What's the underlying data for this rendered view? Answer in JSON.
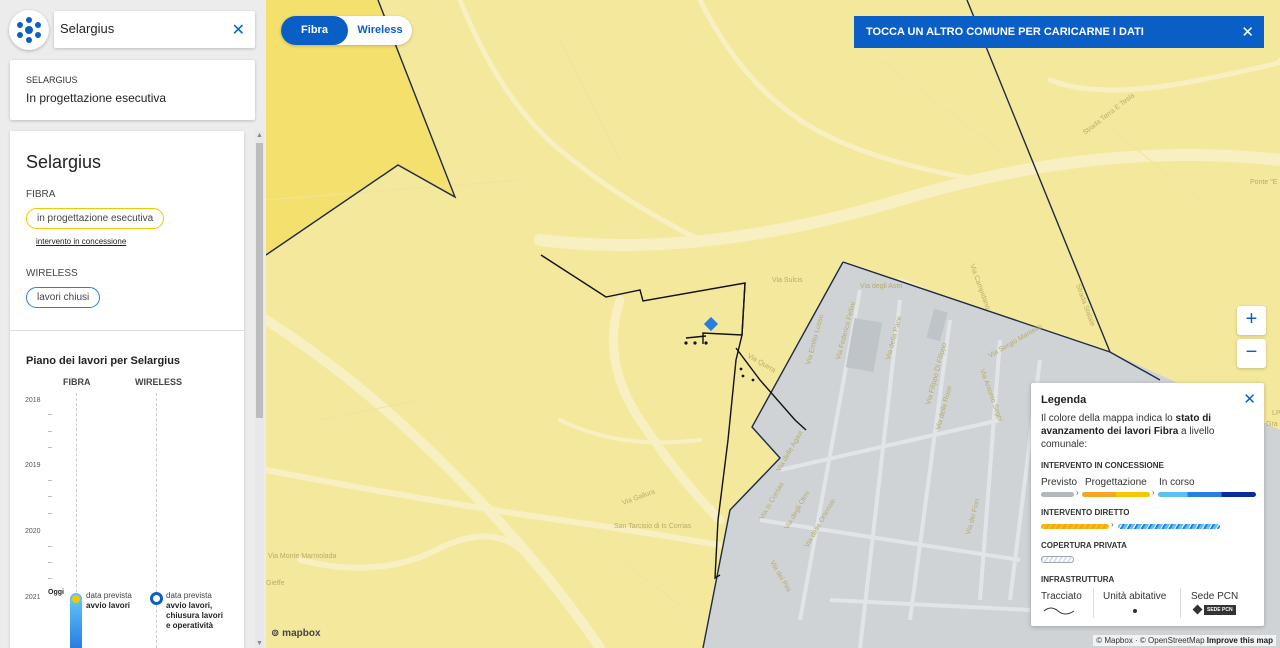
{
  "search": {
    "value": "Selargius",
    "clear_icon": "close-icon"
  },
  "status_card": {
    "comune": "SELARGIUS",
    "status": "In progettazione esecutiva"
  },
  "panel": {
    "title": "Selargius",
    "fibra_label": "FIBRA",
    "fibra_pill": "in progettazione esecutiva",
    "fibra_link": "intervento in concessione",
    "wireless_label": "WIRELESS",
    "wireless_pill": "lavori chiusi",
    "plan_title": "Piano dei lavori per Selargius",
    "col_fibra": "FIBRA",
    "col_wireless": "WIRELESS",
    "years": [
      "2018",
      "2019",
      "2020",
      "2021"
    ],
    "oggi": "Oggi",
    "fibra_event": [
      "data prevista",
      "avvio lavori"
    ],
    "wireless_event": [
      "data prevista",
      "avvio lavori,",
      "chiusura lavori",
      "e operatività"
    ]
  },
  "toggle": {
    "active": "Fibra",
    "inactive": "Wireless"
  },
  "banner": {
    "text": "TOCCA UN ALTRO COMUNE PER CARICARNE I DATI"
  },
  "zoom": {
    "in": "+",
    "out": "−"
  },
  "legend": {
    "title": "Legenda",
    "desc_pre": "Il colore della mappa indica lo ",
    "desc_bold": "stato di avanzamento dei lavori Fibra",
    "desc_post": " a livello comunale:",
    "concessione": "INTERVENTO IN CONCESSIONE",
    "previsto": "Previsto",
    "progettazione": "Progettazione",
    "in_corso": "In corso",
    "diretto": "INTERVENTO DIRETTO",
    "privata": "COPERTURA PRIVATA",
    "infrastruttura": "INFRASTRUTTURA",
    "tracciato": "Tracciato",
    "unita": "Unità abitative",
    "sede": "Sede PCN",
    "sede_badge": "SEDE PCN"
  },
  "map": {
    "mapbox": "mapbox",
    "attribution": [
      "© Mapbox",
      "© OpenStreetMap",
      "Improve this map"
    ],
    "road_labels": [
      "Via Sulcis",
      "Via degli Astri",
      "Via Quirra",
      "Via Gallura",
      "San Tarcisio di Is Corrias",
      "Via Monte Marmolada",
      "Gieffe",
      "Strada Terra E Tesla",
      "Ponte \"E",
      "Via Campidano",
      "Strada Statale",
      "Via delle Agavi",
      "Via Is Corrias",
      "Via degli Olmi",
      "Via delle Ortensie",
      "Via dei Pini",
      "Via dei Fiori",
      "Via Sergio Mantello",
      "Via Antonio Segni",
      "Via Emilio Lussu",
      "Via Federico Fellini",
      "Via della Pace",
      "Via dei Fiori",
      "Via delle Rose",
      "Via Filippo Di Filippo",
      "LP",
      "Gra"
    ]
  },
  "colors": {
    "accent": "#0a5fc7",
    "map_yellow": "#f4e89c",
    "dark_yellow": "#f5e06e",
    "grey_area": "#cfd3d6"
  }
}
